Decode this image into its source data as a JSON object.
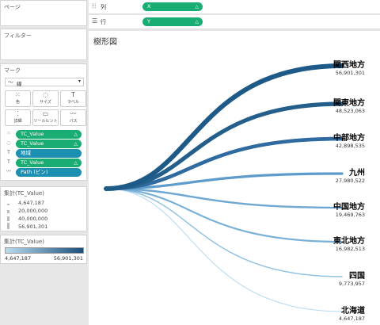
{
  "left": {
    "pages_title": "ページ",
    "filters_title": "フィルター",
    "marks": {
      "title": "マーク",
      "mark_type": "線",
      "buttons": [
        {
          "glyph": "⁙",
          "label": "色"
        },
        {
          "glyph": "◌",
          "label": "サイズ"
        },
        {
          "glyph": "T",
          "label": "ラベル"
        },
        {
          "glyph": "⁚",
          "label": "詳細"
        },
        {
          "glyph": "▭",
          "label": "ツールヒント"
        },
        {
          "glyph": "〰",
          "label": "パス"
        }
      ],
      "rows": [
        {
          "icon": "⁙",
          "field": "TC_Value",
          "kind": "measure"
        },
        {
          "icon": "◌",
          "field": "TC_Value",
          "kind": "measure"
        },
        {
          "icon": "T",
          "field": "地域",
          "kind": "dimension"
        },
        {
          "icon": "T",
          "field": "TC_Value",
          "kind": "measure"
        },
        {
          "icon": "〰",
          "field": "Path (ビン)",
          "kind": "dimension"
        }
      ]
    },
    "size_legend": {
      "title": "集計(TC_Value)",
      "items": [
        "4,647,187",
        "20,000,000",
        "40,000,000",
        "56,901,301"
      ]
    },
    "color_legend": {
      "title": "集計(TC_Value)",
      "min": "4,647,187",
      "max": "56,901,301",
      "color_low": "#b9dcef",
      "color_high": "#1b4f7a"
    }
  },
  "shelves": {
    "columns": {
      "label": "列",
      "pill": "X"
    },
    "rows": {
      "label": "行",
      "pill": "Y"
    }
  },
  "sheet": {
    "title": "樹形図"
  },
  "chart_data": {
    "type": "sankey-tree",
    "categories": [
      "関西地方",
      "関東地方",
      "中部地方",
      "九州",
      "中国地方",
      "東北地方",
      "四国",
      "北海道"
    ],
    "values": [
      56901301,
      48523063,
      42898535,
      27980522,
      19469763,
      16982513,
      9773957,
      4647187
    ],
    "value_labels": [
      "56,901,301",
      "48,523,063",
      "42,898,535",
      "27,980,522",
      "19,469,763",
      "16,982,513",
      "9,773,957",
      "4,647,187"
    ],
    "colors": [
      "#1d5a87",
      "#245f8c",
      "#2f6aa0",
      "#5c9bcb",
      "#6ea8d3",
      "#78b0d8",
      "#92c3e3",
      "#b3d8ef"
    ]
  }
}
